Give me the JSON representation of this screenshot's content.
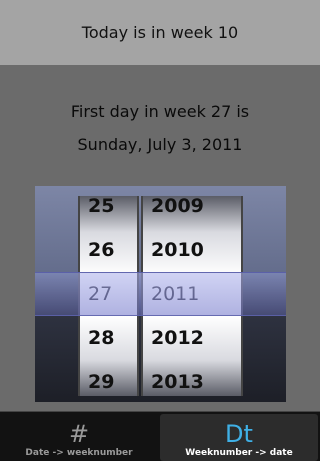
{
  "header": {
    "title": "Today is in week 10"
  },
  "result": {
    "line1": "First day in week 27 is",
    "line2": "Sunday, July 3, 2011"
  },
  "picker": {
    "weeks": [
      "25",
      "26",
      "27",
      "28",
      "29"
    ],
    "years": [
      "2009",
      "2010",
      "2011",
      "2012",
      "2013"
    ],
    "selected_week": "27",
    "selected_year": "2011"
  },
  "tabs": [
    {
      "glyph": "#",
      "label": "Date -> weeknumber",
      "icon": "hash-icon"
    },
    {
      "glyph": "Dt",
      "label": "Weeknumber -> date",
      "icon": "dt-icon"
    }
  ],
  "colors": {
    "accent": "#3fb0e6"
  }
}
